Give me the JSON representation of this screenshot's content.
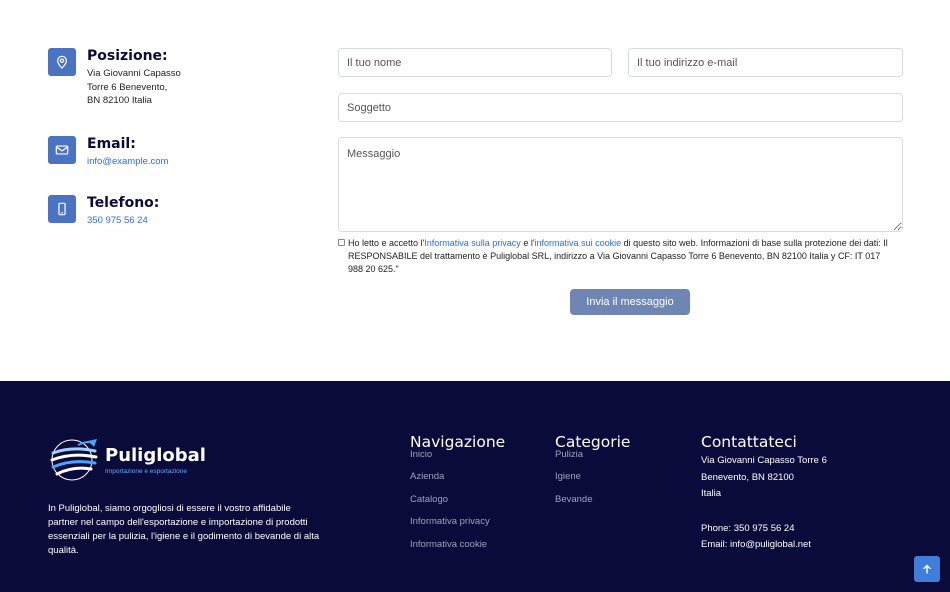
{
  "contact_info": {
    "position": {
      "title": "Posizione:",
      "lines": [
        "Via Giovanni Capasso",
        "Torre 6 Benevento,",
        "BN 82100 Italia"
      ]
    },
    "email": {
      "title": "Email:",
      "value": "info@example.com"
    },
    "phone": {
      "title": "Telefono:",
      "value": "350 975 56 24"
    }
  },
  "form": {
    "name_placeholder": "Il tuo nome",
    "email_placeholder": "Il tuo indirizzo e-mail",
    "subject_placeholder": "Soggetto",
    "message_placeholder": "Messaggio",
    "consent": {
      "part1": "Ho letto e accetto l'",
      "privacy_link": "Informativa sulla privacy",
      "part2": " e l'",
      "cookie_link": "informativa sui cookie",
      "part3": " di questo sito web. Informazioni di base sulla protezione dei dati: Il RESPONSABILE del trattamento è Puliglobal SRL, indirizzo a Via Giovanni Capasso Torre 6 Benevento, BN 82100 Italia y CF: IT 017 988 20 625.\""
    },
    "submit_label": "Invia il messaggio"
  },
  "footer": {
    "brand_name": "Puliglobal",
    "brand_tagline": "Importazione e esportazione",
    "about": "In Puliglobal, siamo orgogliosi di essere il vostro affidabile partner nel campo dell'esportazione e importazione di prodotti essenziali per la pulizia, l'igiene e il godimento di bevande di alta qualità.",
    "navigation": {
      "title": "Navigazione",
      "items": [
        "Inicio",
        "Azienda",
        "Catalogo",
        "Informativa privacy",
        "Informativa cookie"
      ]
    },
    "categories": {
      "title": "Categorie",
      "items": [
        "Pulizia",
        "Igiene",
        "Bevande"
      ]
    },
    "contact": {
      "title": "Contattateci",
      "address": [
        "Via Giovanni Capasso Torre 6",
        "Benevento, BN 82100",
        "Italia"
      ],
      "phone": "Phone: 350 975 56 24",
      "email": "Email: info@puliglobal.net"
    }
  },
  "colors": {
    "accent": "#4a73c4",
    "link": "#2e6fd6",
    "footer_bg": "#0b0b3b",
    "button": "#6f86b5",
    "back_to_top": "#3f7ed9"
  },
  "icons": {
    "position": "map-pin-icon",
    "email": "envelope-icon",
    "phone": "smartphone-icon",
    "back_to_top": "arrow-up-icon"
  }
}
